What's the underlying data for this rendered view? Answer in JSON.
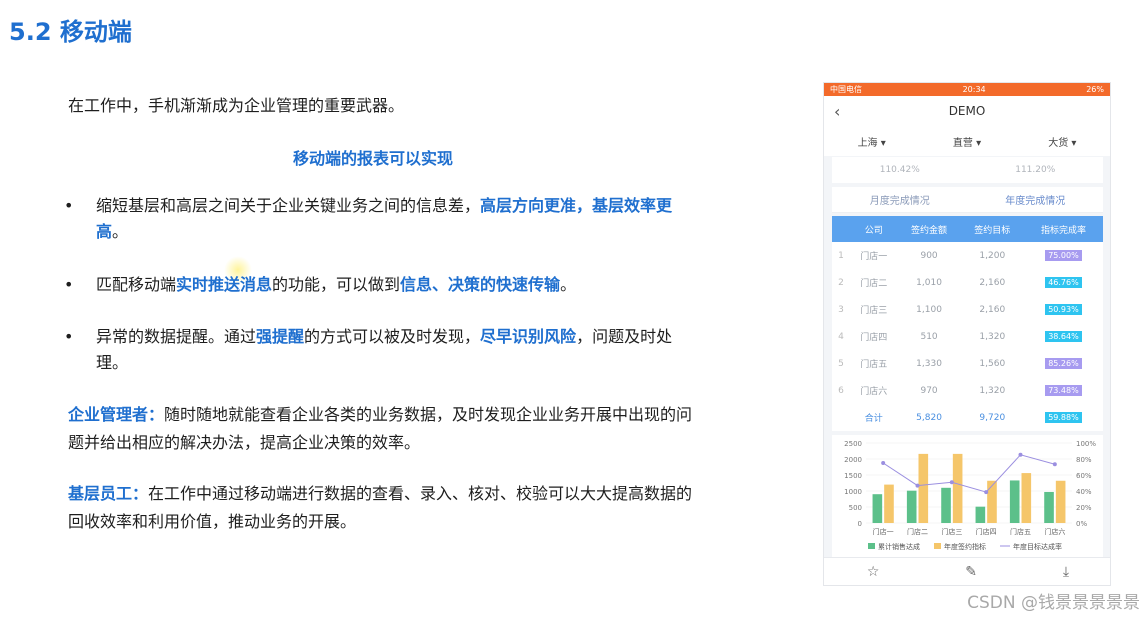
{
  "slide": {
    "title": "5.2 移动端",
    "intro": "在工作中，手机渐渐成为企业管理的重要武器。",
    "subhead": "移动端的报表可以实现",
    "bullets": [
      {
        "p1": "缩短基层和高层之间关于企业关键业务之间的信息差，",
        "h1": "高层方向更准，基层效率更高",
        "p2": "。",
        "h2": "",
        "p3": ""
      },
      {
        "p1": "匹配移动端",
        "h1": "实时推送消息",
        "p2": "的功能，可以做到",
        "h2": "信息、决策的快速传输",
        "p3": "。"
      },
      {
        "p1": "异常的数据提醒。通过",
        "h1": "强提醒",
        "p2": "的方式可以被及时发现，",
        "h2": "尽早识别风险",
        "p3": "，问题及时处理。"
      }
    ],
    "manager": {
      "lead": "企业管理者：",
      "text": "随时随地就能查看企业各类的业务数据，及时发现企业业务开展中出现的问题并给出相应的解决办法，提高企业决策的效率。"
    },
    "staff": {
      "lead": "基层员工：",
      "text": "在工作中通过移动端进行数据的查看、录入、核对、校验可以大大提高数据的回收效率和利用价值，推动业务的开展。"
    },
    "watermark": "CSDN @钱景景景景景"
  },
  "phone": {
    "status_left": "中国电信",
    "status_time": "20:34",
    "status_right": "26%",
    "nav_title": "DEMO",
    "filters": [
      "上海 ▾",
      "直营 ▾",
      "大货 ▾"
    ],
    "pct_left": "110.42%",
    "pct_right": "111.20%",
    "tabs": [
      "月度完成情况",
      "年度完成情况"
    ],
    "table": {
      "headers": [
        "公司",
        "签约金额",
        "签约目标",
        "指标完成率"
      ],
      "rows": [
        {
          "idx": "1",
          "store": "门店一",
          "amount": "900",
          "target": "1,200",
          "rate": "75.00%"
        },
        {
          "idx": "2",
          "store": "门店二",
          "amount": "1,010",
          "target": "2,160",
          "rate": "46.76%"
        },
        {
          "idx": "3",
          "store": "门店三",
          "amount": "1,100",
          "target": "2,160",
          "rate": "50.93%"
        },
        {
          "idx": "4",
          "store": "门店四",
          "amount": "510",
          "target": "1,320",
          "rate": "38.64%"
        },
        {
          "idx": "5",
          "store": "门店五",
          "amount": "1,330",
          "target": "1,560",
          "rate": "85.26%"
        },
        {
          "idx": "6",
          "store": "门店六",
          "amount": "970",
          "target": "1,320",
          "rate": "73.48%"
        }
      ],
      "total": {
        "label": "合计",
        "amount": "5,820",
        "target": "9,720",
        "rate": "59.88%"
      }
    },
    "colors": {
      "badge_high": "#a79bf0",
      "badge_low": "#2ec4f0",
      "bar_sales": "#5cc08a",
      "bar_target": "#f5c66a",
      "line_rate": "#9b8fe0"
    }
  },
  "chart_data": {
    "type": "bar",
    "categories": [
      "门店一",
      "门店二",
      "门店三",
      "门店四",
      "门店五",
      "门店六"
    ],
    "series": [
      {
        "name": "累计销售达成",
        "values": [
          900,
          1010,
          1100,
          510,
          1330,
          970
        ]
      },
      {
        "name": "年度签约指标",
        "values": [
          1200,
          2160,
          2160,
          1320,
          1560,
          1320
        ]
      },
      {
        "name": "年度目标达成率",
        "values": [
          0.75,
          0.4676,
          0.5093,
          0.3864,
          0.8526,
          0.7348
        ],
        "axis": "right"
      }
    ],
    "y_ticks": [
      "2500",
      "2000",
      "1500",
      "1000",
      "500",
      "0"
    ],
    "y2_ticks": [
      "100%",
      "80%",
      "60%",
      "40%",
      "20%",
      "0%"
    ],
    "ylim": [
      0,
      2500
    ],
    "y2lim": [
      0,
      1
    ]
  }
}
